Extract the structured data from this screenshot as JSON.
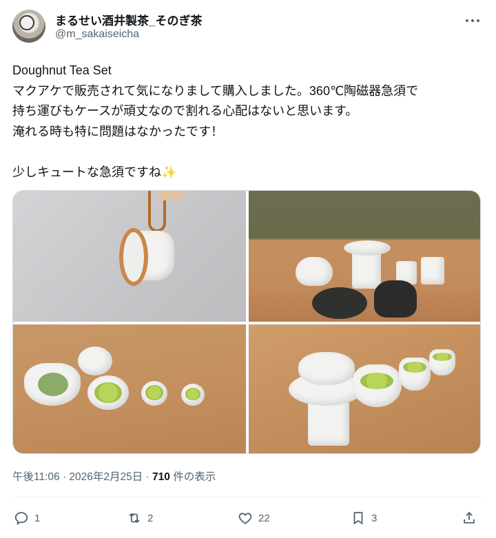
{
  "author": {
    "name": "まるせい酒井製茶_そのぎ茶",
    "handle": "@m_sakaiseicha",
    "avatar_icon": "avatar"
  },
  "tweet": {
    "lines": [
      "Doughnut Tea Set",
      "マクアケで販売されて気になりまして購入しました。360℃陶磁器急須で",
      "持ち運びもケースが頑丈なので割れる心配はないと思います。",
      "淹れる時も特に問題はなかったです！",
      "",
      "少しキュートな急須ですね"
    ],
    "sparkle": "✨"
  },
  "meta": {
    "time": "午後11:06",
    "separator1": " · ",
    "date": "2026年2月25日",
    "separator2": " · ",
    "views": "710",
    "views_label": " 件の表示"
  },
  "actions": {
    "reply_count": "1",
    "retweet_count": "2",
    "like_count": "22",
    "bookmark_count": "3"
  },
  "icons": {
    "more": "more-icon",
    "reply": "reply-icon",
    "retweet": "retweet-icon",
    "like": "heart-icon",
    "bookmark": "bookmark-icon",
    "share": "share-icon"
  }
}
